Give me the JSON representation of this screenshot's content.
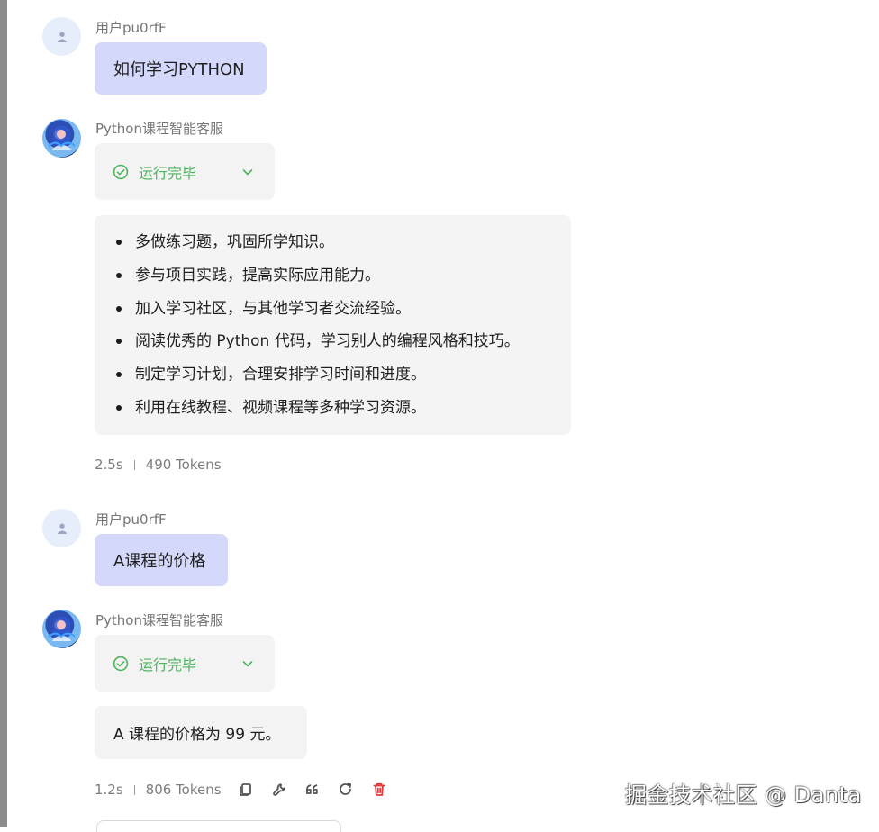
{
  "theme": {
    "user_bubble": "#d4d8fb",
    "bot_card": "#f3f3f3",
    "success": "#4db45f",
    "danger": "#e03a3a",
    "muted_text": "#757575"
  },
  "messages": [
    {
      "role": "user",
      "author": "用户pu0rfF",
      "text": "如何学习PYTHON",
      "avatar_icon": "user-icon"
    },
    {
      "role": "assistant",
      "author": "Python课程智能客服",
      "avatar_icon": "bot-avatar",
      "status": "运行完毕",
      "answer_items": [
        "多做练习题，巩固所学知识。",
        "参与项目实践，提高实际应用能力。",
        "加入学习社区，与其他学习者交流经验。",
        "阅读优秀的 Python 代码，学习别人的编程风格和技巧。",
        "制定学习计划，合理安排学习时间和进度。",
        "利用在线教程、视频课程等多种学习资源。"
      ],
      "duration": "2.5s",
      "tokens": "490 Tokens"
    },
    {
      "role": "user",
      "author": "用户pu0rfF",
      "text": "A课程的价格",
      "avatar_icon": "user-icon"
    },
    {
      "role": "assistant",
      "author": "Python课程智能客服",
      "avatar_icon": "bot-avatar",
      "status": "运行完毕",
      "answer": "A 课程的价格为 99 元。",
      "duration": "1.2s",
      "tokens": "806 Tokens",
      "actions": [
        "copy-icon",
        "wrench-icon",
        "quote-icon",
        "refresh-icon",
        "delete-icon"
      ]
    }
  ],
  "watermark": "掘金技术社区 @ Danta"
}
